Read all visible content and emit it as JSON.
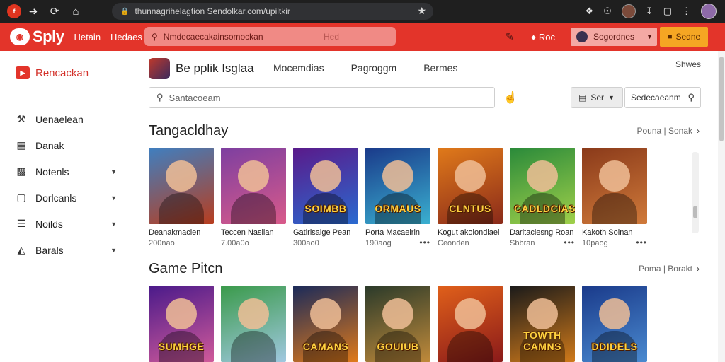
{
  "browser": {
    "url": "thunnagrihelagtion Sendolkar.com/upiltkir",
    "favicon_text": "f"
  },
  "header": {
    "logo_word": "Sply",
    "links": [
      "Hetain",
      "Hedaes"
    ],
    "search_placeholder": "Nmdecaecakainsomockan",
    "search_hint": "Hed",
    "bell_label": "Roc",
    "user_label": "Sogordnes",
    "sign_label": "Sedne",
    "colors": {
      "brand": "#e3342a",
      "accent": "#f5a623"
    }
  },
  "sidebar": {
    "brand": "Rencackan",
    "items": [
      {
        "label": "Uenaelean",
        "icon": "hammer-icon"
      },
      {
        "label": "Danak",
        "icon": "grid-icon"
      },
      {
        "label": "Notenls",
        "icon": "briefcase-icon"
      },
      {
        "label": "Dorlcanls",
        "icon": "window-icon"
      },
      {
        "label": "Noilds",
        "icon": "list-icon"
      },
      {
        "label": "Barals",
        "icon": "bag-icon"
      }
    ]
  },
  "main": {
    "store_title": "Be pplik Isglaa",
    "tabs": [
      "Mocemdias",
      "Pagroggm",
      "Bermes"
    ],
    "more": "Shwes",
    "search_placeholder": "Santacoeam",
    "filter_label": "Ser",
    "sort_label": "Sedecaeanm"
  },
  "sections": [
    {
      "title": "Tangacldhay",
      "link": "Pouna | Sonak",
      "cards": [
        {
          "name": "Deanakmaclen",
          "meta": "200nao",
          "banner": "",
          "bg": "#3f7fc0",
          "bg2": "#b83d1e",
          "dots": false
        },
        {
          "name": "Teccen Naslian",
          "meta": "7.00a0o",
          "banner": "",
          "bg": "#7d3fa0",
          "bg2": "#d95a8a",
          "dots": false
        },
        {
          "name": "Gatirisalge Pean",
          "meta": "300ao0",
          "banner": "SOIMBB",
          "bg": "#5a1a8a",
          "bg2": "#2a6ad0",
          "dots": false
        },
        {
          "name": "Porta Macaelrin",
          "meta": "190aog",
          "banner": "ORMAUS",
          "bg": "#1a3a8a",
          "bg2": "#3ab0d0",
          "dots": true
        },
        {
          "name": "Kogut akolondiael",
          "meta": "Ceonden",
          "banner": "CLNTUS",
          "bg": "#e07a1a",
          "bg2": "#8a2a1a",
          "dots": false
        },
        {
          "name": "Darltaclesng Roan",
          "meta": "Sbbran",
          "banner": "CADLDCIAS",
          "bg": "#2a8a3a",
          "bg2": "#a0d04a",
          "dots": true
        },
        {
          "name": "Kakoth Solnan",
          "meta": "10paog",
          "banner": "",
          "bg": "#8a3a1a",
          "bg2": "#d07a3a",
          "dots": true
        }
      ]
    },
    {
      "title": "Game Pitcn",
      "link": "Poma | Borakt",
      "cards": [
        {
          "name": "",
          "meta": "",
          "banner": "SUMHGE",
          "bg": "#4a1a8a",
          "bg2": "#d05a9a",
          "dots": false
        },
        {
          "name": "",
          "meta": "",
          "banner": "",
          "bg": "#3a9a4a",
          "bg2": "#a0c8e0",
          "dots": false
        },
        {
          "name": "",
          "meta": "",
          "banner": "CAMANS",
          "bg": "#1a2a5a",
          "bg2": "#e07a1a",
          "dots": false
        },
        {
          "name": "",
          "meta": "",
          "banner": "GOUIUB",
          "bg": "#2a3a2a",
          "bg2": "#c08a3a",
          "dots": false
        },
        {
          "name": "",
          "meta": "",
          "banner": "",
          "bg": "#e0601a",
          "bg2": "#8a1a1a",
          "dots": false
        },
        {
          "name": "",
          "meta": "",
          "banner": "TOWTH CAMNS",
          "bg": "#1a1a1a",
          "bg2": "#d07a1a",
          "dots": false
        },
        {
          "name": "",
          "meta": "",
          "banner": "DDIDELS",
          "bg": "#1a3a8a",
          "bg2": "#4a8ad0",
          "dots": false
        }
      ]
    }
  ]
}
